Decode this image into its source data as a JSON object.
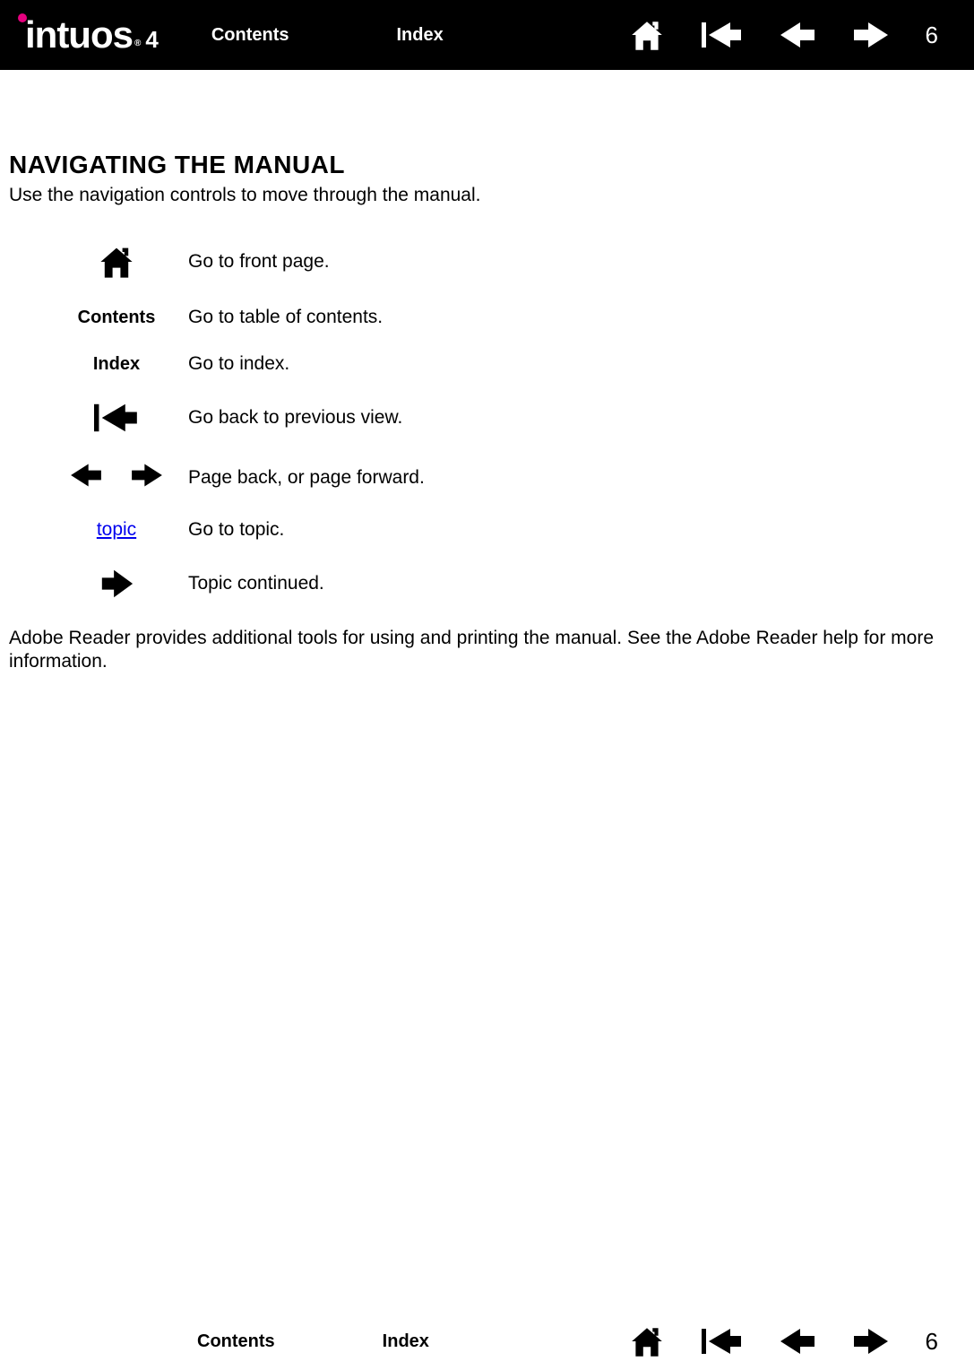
{
  "brand": {
    "name": "intuos",
    "suffix": "4",
    "reg": "®"
  },
  "nav": {
    "contents": "Contents",
    "index": "Index"
  },
  "page_number_top": "6",
  "page_number_bottom": "6",
  "heading": "NAVIGATING THE MANUAL",
  "intro": "Use the navigation controls to move through the manual.",
  "rows": {
    "front_page": "Go to front page.",
    "contents_label": "Contents",
    "contents_desc": "Go to table of contents.",
    "index_label": "Index",
    "index_desc": "Go to index.",
    "prev_view": "Go back to previous view.",
    "page_nav": "Page back, or page forward.",
    "topic_label": "topic",
    "topic_desc": "Go to topic.",
    "continued": "Topic continued."
  },
  "footer_text": "Adobe Reader provides additional tools for using and printing the manual.  See the Adobe Reader help for more information."
}
